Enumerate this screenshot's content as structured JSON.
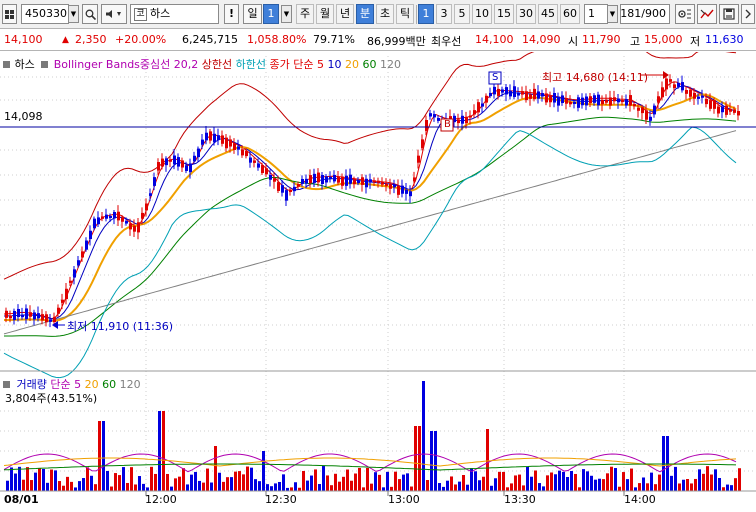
{
  "toolbar": {
    "code": "450330",
    "stock_badge": "코",
    "stock_name": "하스",
    "tabs": [
      "!",
      "일",
      "1",
      "주",
      "월",
      "년",
      "분",
      "초",
      "틱"
    ],
    "interval_buttons": [
      "1",
      "3",
      "5",
      "10",
      "15",
      "30",
      "45",
      "60"
    ],
    "period_value": "1",
    "count_value": "181/900"
  },
  "infobar": {
    "price": "14,100",
    "change": "2,350",
    "change_pct": "+20.00%",
    "volume": "6,245,715",
    "volume_ratio": "1,058.80%",
    "turnover": "79.71%",
    "amount": "86,999백만",
    "best_ask_label": "최우선",
    "best_ask": "14,100",
    "best_bid": "14,090",
    "open_label": "시",
    "open": "11,790",
    "high_label": "고",
    "high": "15,000",
    "low_label": "저",
    "low": "11,630"
  },
  "price_panel": {
    "title": "하스",
    "bb_label": "Bollinger Bands중심선 20,2",
    "upper_label": "상한선",
    "lower_label": "하한선",
    "ma_label": "종가 단순 5",
    "ma_periods": [
      "10",
      "20",
      "60",
      "120"
    ],
    "ref_price": "14,098",
    "high_marker": "최고 14,680 (14:11)",
    "low_marker": "최저 11,910 (11:36)",
    "signal_s": "S",
    "signal_b": "B"
  },
  "volume_panel": {
    "title": "거래량",
    "ma_label": "단순 5",
    "ma_periods": [
      "20",
      "60",
      "120"
    ],
    "value": "3,804주(43.51%)"
  },
  "time_axis": {
    "labels": [
      "08/01",
      "12:00",
      "12:30",
      "13:00",
      "13:30",
      "14:00"
    ]
  },
  "colors": {
    "up": "#e00000",
    "down": "#0000e0",
    "bb_upper": "#c00000",
    "bb_lower": "#00a0b4",
    "ma5": "#e00000",
    "ma10": "#0000c0",
    "ma20": "#f0a000",
    "ma60": "#008000",
    "ma120": "#808080",
    "ref_line": "#0000a0"
  },
  "chart_data": {
    "type": "candlestick",
    "ylim": [
      11000,
      15000
    ],
    "reference_price": 14098,
    "high": {
      "price": 14680,
      "time": "14:11"
    },
    "low": {
      "price": 11910,
      "time": "11:36"
    }
  }
}
